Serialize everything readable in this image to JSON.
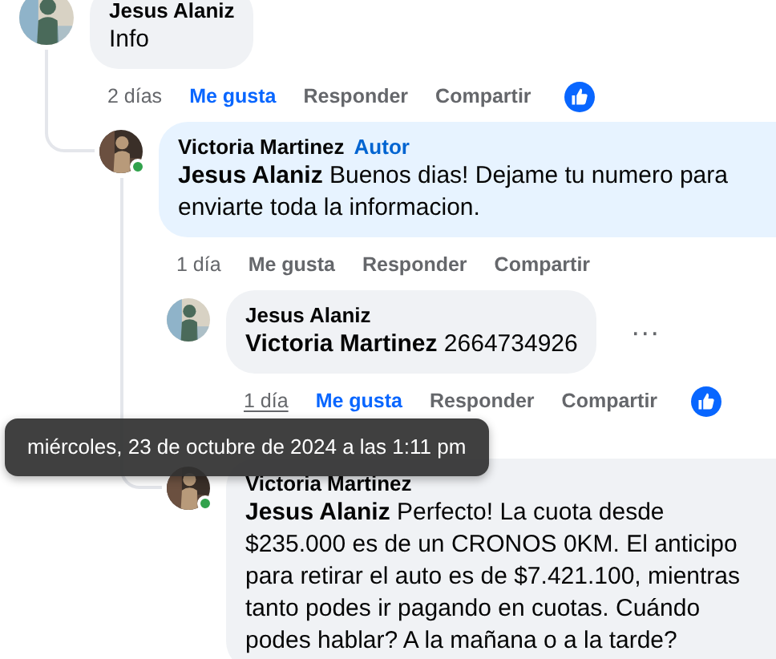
{
  "comments": [
    {
      "author": "Jesus Alaniz",
      "text": "Info",
      "online": false,
      "highlighted": false,
      "actions": {
        "time": "2 días",
        "time_hovered": false,
        "like": "Me gusta",
        "liked": true,
        "reply": "Responder",
        "share": "Compartir",
        "reaction_icon": true
      },
      "children": [
        {
          "author": "Victoria Martinez",
          "badge": "Autor",
          "text": "**Jesus Alaniz** Buenos dias! Dejame tu numero para enviarte toda la informacion.",
          "online": true,
          "highlighted": true,
          "actions": {
            "time": "1 día",
            "time_hovered": false,
            "like": "Me gusta",
            "liked": false,
            "reply": "Responder",
            "share": "Compartir",
            "reaction_icon": false
          },
          "children": [
            {
              "author": "Jesus Alaniz",
              "text": "**Victoria Martinez** 2664734926",
              "online": false,
              "highlighted": false,
              "more_menu": "···",
              "actions": {
                "time": "1 día",
                "time_hovered": true,
                "like": "Me gusta",
                "liked": true,
                "reply": "Responder",
                "share": "Compartir",
                "reaction_icon": true
              }
            },
            {
              "author": "Victoria Martinez",
              "text": "**Jesus Alaniz** Perfecto! La cuota desde $235.000 es de un CRONOS 0KM. El anticipo para retirar el auto es de $7.421.100, mientras tanto podes ir pagando en cuotas. Cuándo podes hablar? A la mañana o a la tarde?",
              "online": true,
              "highlighted": false
            }
          ]
        }
      ]
    }
  ],
  "tooltip": "miércoles, 23 de octubre de 2024 a las 1:11 pm"
}
